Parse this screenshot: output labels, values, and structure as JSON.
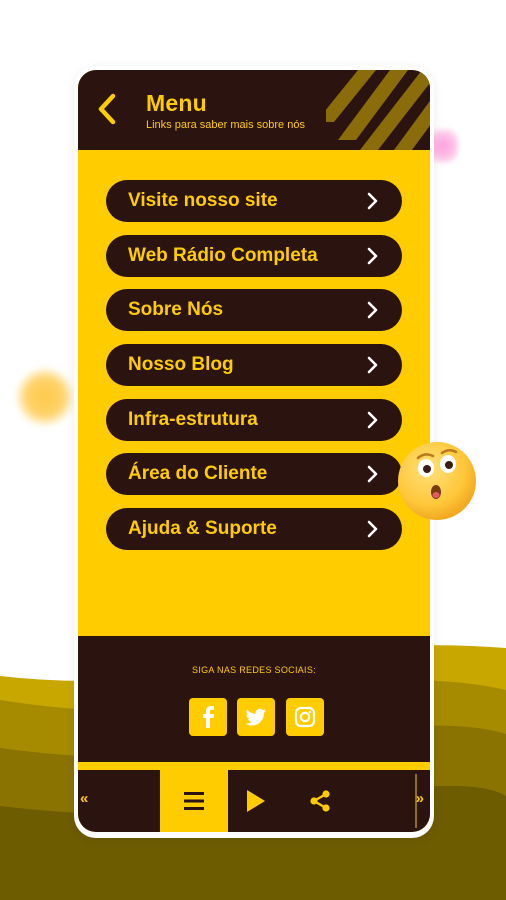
{
  "header": {
    "title": "Menu",
    "subtitle": "Links para saber mais sobre nós",
    "back_icon": "chevron-left-icon"
  },
  "menu": {
    "items": [
      {
        "label": "Visite nosso site"
      },
      {
        "label": "Web Rádio Completa"
      },
      {
        "label": "Sobre Nós"
      },
      {
        "label": "Nosso Blog"
      },
      {
        "label": "Infra-estrutura"
      },
      {
        "label": "Área do Cliente"
      },
      {
        "label": "Ajuda & Suporte"
      }
    ]
  },
  "social": {
    "title": "SIGA NAS REDES SOCIAIS:",
    "icons": [
      "facebook-icon",
      "twitter-icon",
      "instagram-icon"
    ]
  },
  "bottom_bar": {
    "prev_label": "«",
    "next_label": "»",
    "icons": [
      "menu-icon",
      "play-icon",
      "share-icon"
    ]
  },
  "colors": {
    "accent": "#ffcc00",
    "dark": "#2b1310",
    "background": "#ffffff"
  }
}
